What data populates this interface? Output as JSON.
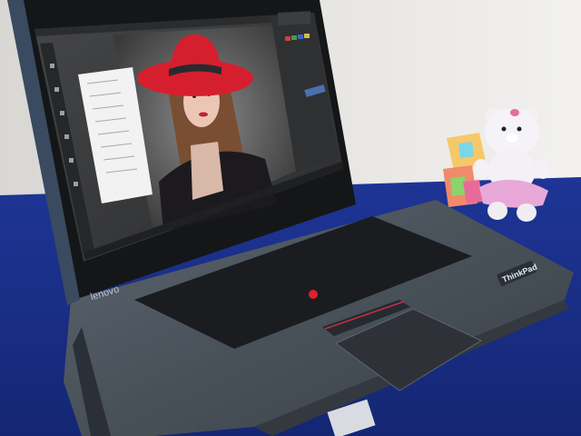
{
  "photo": {
    "subject": "laptop-with-photo-editor",
    "colors": {
      "wall": "#ecebe8",
      "desk_cloth": "#1c2f8e",
      "laptop_body": "#4f5760",
      "laptop_bezel": "#141618",
      "editor_bg": "#3a3b3d",
      "hat": "#d61f2e",
      "trackpoint": "#e02030",
      "teddy": "#f3f1f6",
      "teddy_skirt": "#e8a8d8"
    }
  },
  "laptop": {
    "brand": "lenovo",
    "badge": "ThinkPad"
  },
  "editor": {
    "icons": [
      "move-tool-icon",
      "lasso-tool-icon",
      "crop-tool-icon",
      "brush-tool-icon",
      "eraser-tool-icon",
      "zoom-tool-icon"
    ]
  }
}
